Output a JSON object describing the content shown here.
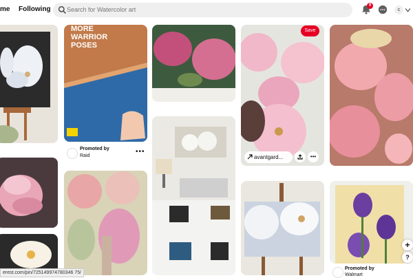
{
  "nav": {
    "home": "me",
    "following": "Following"
  },
  "search": {
    "placeholder": "Search for Watercolor art"
  },
  "notifications": {
    "count": "9"
  },
  "account": {
    "initial": "c"
  },
  "pins": {
    "warrior": {
      "headline": "MORE WARRIOR POSES",
      "promoted_by": "Promoted by",
      "advertiser": "Raid",
      "logo_text": "Raid"
    },
    "cherry": {
      "save": "Save",
      "link": "avantgard..."
    },
    "tulips": {
      "promoted_by": "Promoted by",
      "advertiser": "Walmart"
    }
  },
  "status_bar": {
    "url": "erest.com/pin/725149974780346 75/"
  },
  "floating": {
    "plus": "+",
    "help": "?"
  },
  "colors": {
    "accent": "#e60023",
    "search_bg": "#efefef"
  }
}
